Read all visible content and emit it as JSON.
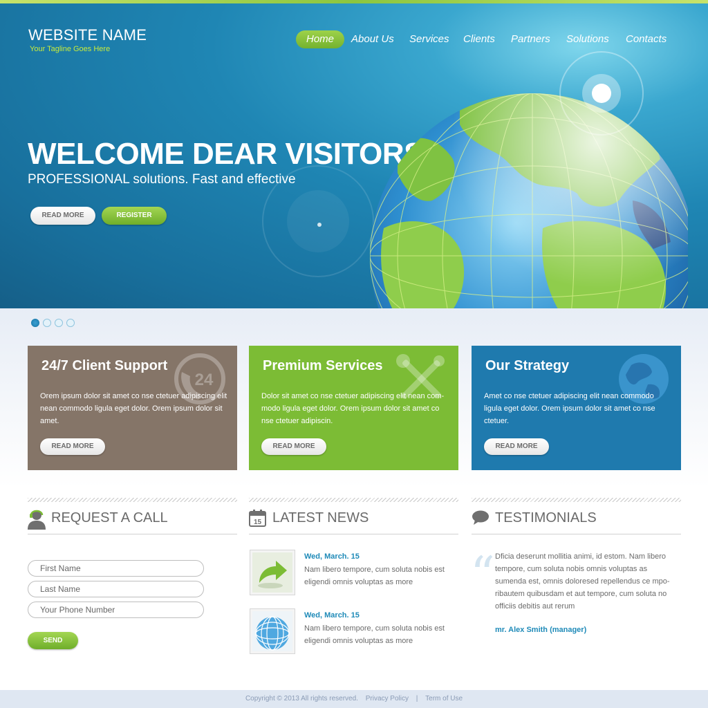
{
  "brand": {
    "name": "WEBSITE NAME",
    "tagline": "Your Tagline Goes Here"
  },
  "nav": {
    "items": [
      "Home",
      "About Us",
      "Services",
      "Clients",
      "Partners",
      "Solutions",
      "Contacts"
    ],
    "active": "Home"
  },
  "hero": {
    "headline": "WELCOME DEAR VISITORS!",
    "subline": "PROFESSIONAL solutions. Fast and effective",
    "read_more_label": "READ MORE",
    "register_label": "REGISTER"
  },
  "slider": {
    "dot_count": 4,
    "active_dot": 1
  },
  "features": [
    {
      "title": "24/7 Client Support",
      "text": "Orem ipsum dolor sit amet co nse ctetuer adipiscing elit nean commodo ligula eget dolor. Orem ipsum dolor sit amet.",
      "button": "READ MORE",
      "icon": "phone-24-icon",
      "color": "#857568"
    },
    {
      "title": "Premium Services",
      "text": "Dolor sit amet co nse ctetuer adipiscing elit nean com-modo ligula eget dolor. Orem ipsum dolor sit amet co nse ctetuer adipiscin.",
      "button": "READ MORE",
      "icon": "tools-icon",
      "color": "#7cbc35"
    },
    {
      "title": "Our Strategy",
      "text": "Amet co nse ctetuer adipiscing elit nean commodo ligula eget dolor. Orem ipsum dolor sit amet co nse ctetuer.",
      "button": "READ MORE",
      "icon": "globe-icon",
      "color": "#1f7aae"
    }
  ],
  "request_call": {
    "title": "REQUEST A CALL",
    "first_name_placeholder": "First Name",
    "last_name_placeholder": "Last Name",
    "phone_placeholder": "Your Phone Number",
    "send_label": "SEND"
  },
  "news": {
    "title": "LATEST NEWS",
    "calendar_day": "15",
    "items": [
      {
        "date": "Wed, March. 15",
        "text": "Nam libero tempore, cum soluta nobis est eligendi omnis voluptas as more",
        "thumb": "arrow-thumb-icon"
      },
      {
        "date": "Wed, March. 15",
        "text": "Nam libero tempore, cum soluta nobis est eligendi omnis voluptas as more",
        "thumb": "globe-thumb-icon"
      }
    ]
  },
  "testimonials": {
    "title": "TESTIMONIALS",
    "quote_mark": "“",
    "text": "Dficia deserunt mollitia animi, id estom. Nam libero tempore, cum soluta nobis omnis voluptas as sumenda est, omnis doloresed repellendus ce mpo-ribautem quibusdam et aut tempore, cum soluta no officiis debitis aut rerum",
    "author": "mr. Alex Smith (manager)"
  },
  "footer": {
    "copyright": "Copyright © 2013  All rights reserved.",
    "privacy": "Privacy Policy",
    "separator": "|",
    "terms": "Term of Use"
  },
  "colors": {
    "hero_blue": "#1f86b4",
    "accent_green": "#7cbc35",
    "link_blue": "#1e8ab8",
    "support_brown": "#857568",
    "strategy_blue": "#1f7aae"
  }
}
